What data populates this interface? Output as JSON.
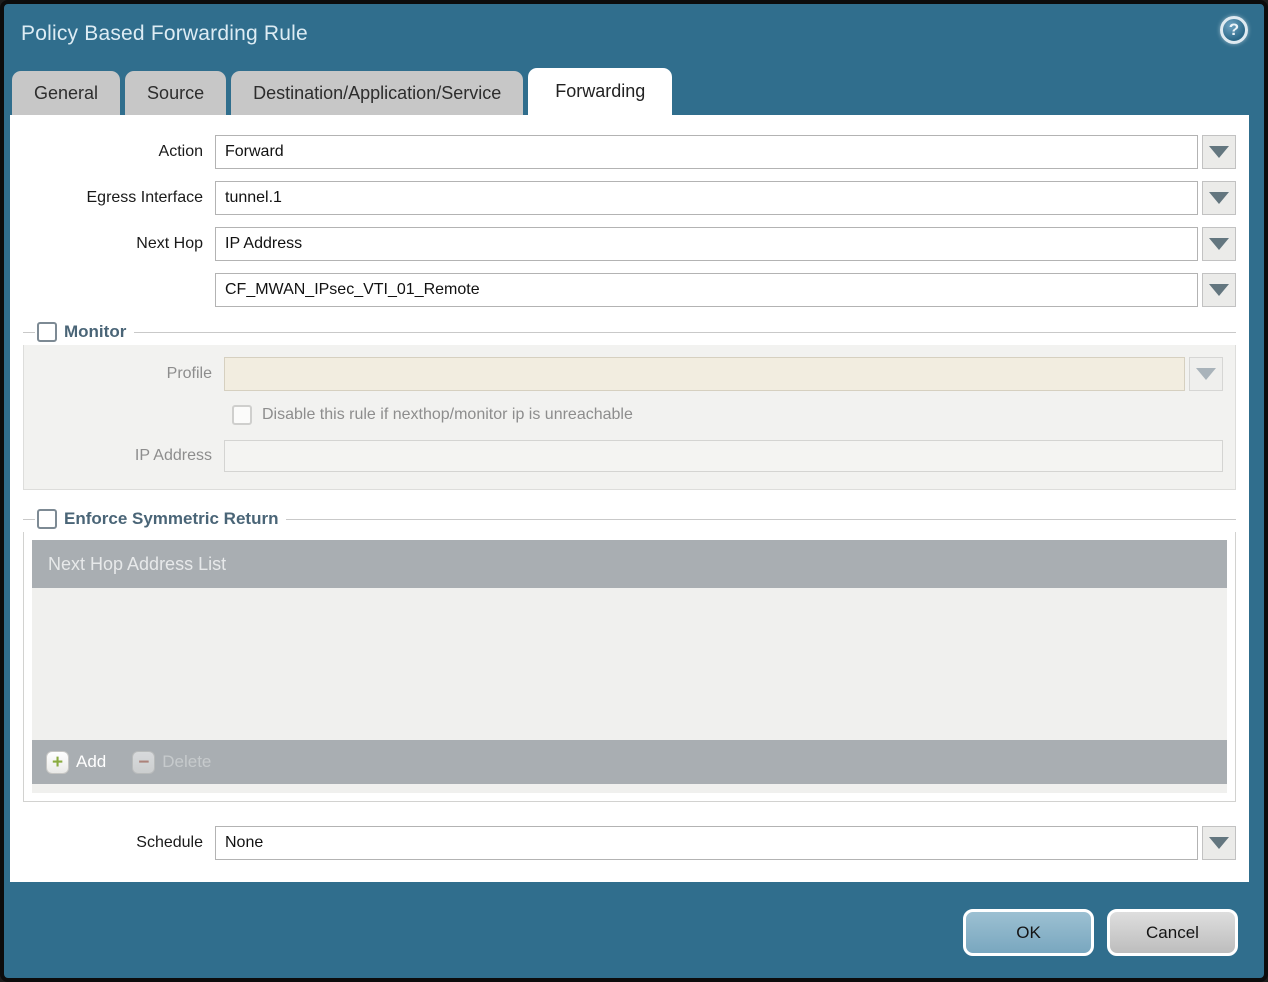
{
  "dialog": {
    "title": "Policy Based Forwarding Rule"
  },
  "icons": {
    "help": "?",
    "add": "+",
    "delete": "−",
    "dropdown": "▼"
  },
  "tabs": [
    {
      "label": "General",
      "active": false
    },
    {
      "label": "Source",
      "active": false
    },
    {
      "label": "Destination/Application/Service",
      "active": false
    },
    {
      "label": "Forwarding",
      "active": true
    }
  ],
  "form": {
    "action": {
      "label": "Action",
      "value": "Forward"
    },
    "egress_interface": {
      "label": "Egress Interface",
      "value": "tunnel.1"
    },
    "next_hop": {
      "label": "Next Hop",
      "value": "IP Address"
    },
    "next_hop_address": {
      "value": "CF_MWAN_IPsec_VTI_01_Remote"
    },
    "schedule": {
      "label": "Schedule",
      "value": "None"
    }
  },
  "monitor": {
    "legend": "Monitor",
    "checked": false,
    "profile": {
      "label": "Profile",
      "value": ""
    },
    "disable_rule": {
      "label": "Disable this rule if nexthop/monitor ip is unreachable",
      "checked": false
    },
    "ip_address": {
      "label": "IP Address",
      "value": ""
    }
  },
  "symmetric_return": {
    "legend": "Enforce Symmetric Return",
    "checked": false,
    "table": {
      "header": "Next Hop Address List",
      "rows": []
    },
    "add_label": "Add",
    "delete_label": "Delete",
    "delete_enabled": false
  },
  "footer": {
    "ok_label": "OK",
    "cancel_label": "Cancel"
  },
  "colors": {
    "teal": "#306e8d",
    "tab_inactive": "#c7c7c7",
    "header_gray": "#a9aeb2",
    "beige": "#f2ede0",
    "ok_blue": "#79a7bf",
    "legend_text": "#4a6577",
    "add_green": "#8aab3f",
    "delete_red": "#b05f4e"
  }
}
